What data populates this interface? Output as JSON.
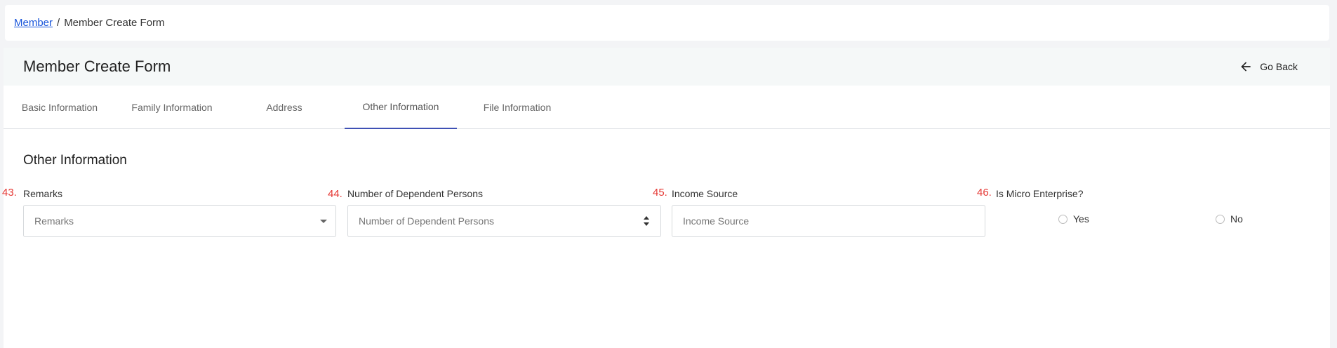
{
  "breadcrumb": {
    "parent_label": "Member",
    "separator": "/",
    "current_label": "Member Create Form"
  },
  "header": {
    "title": "Member Create Form",
    "go_back_label": "Go Back"
  },
  "tabs": [
    {
      "label": "Basic Information",
      "active": false
    },
    {
      "label": "Family Information",
      "active": false
    },
    {
      "label": "Address",
      "active": false
    },
    {
      "label": "Other Information",
      "active": true
    },
    {
      "label": "File Information",
      "active": false
    }
  ],
  "section": {
    "title": "Other Information"
  },
  "fields": {
    "remarks": {
      "number": "43.",
      "label": "Remarks",
      "placeholder": "Remarks",
      "value": ""
    },
    "dependents": {
      "number": "44.",
      "label": "Number of Dependent Persons",
      "placeholder": "Number of Dependent Persons",
      "value": ""
    },
    "income_source": {
      "number": "45.",
      "label": "Income Source",
      "placeholder": "Income Source",
      "value": ""
    },
    "micro_enterprise": {
      "number": "46.",
      "label": "Is Micro Enterprise?",
      "options": [
        {
          "label": "Yes",
          "selected": false
        },
        {
          "label": "No",
          "selected": false
        }
      ]
    }
  },
  "colors": {
    "accent": "#3f51b5",
    "link": "#1a56db",
    "field_number": "#e53935"
  },
  "icons": {
    "go_back": "arrow-left-icon",
    "dropdown": "caret-down-icon",
    "stepper": "sort-icon"
  }
}
